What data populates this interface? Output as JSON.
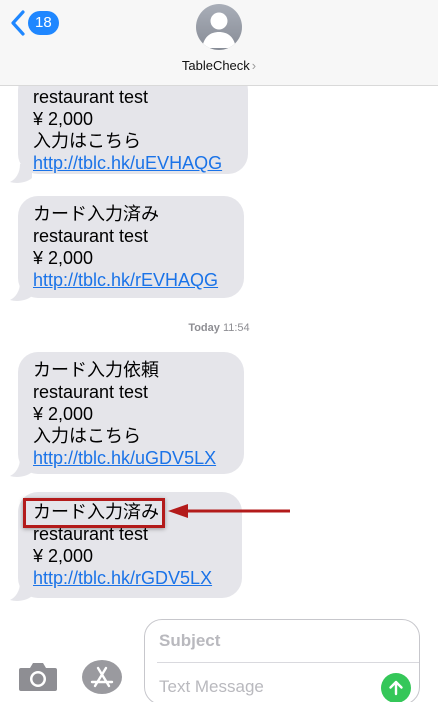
{
  "header": {
    "back_badge": "18",
    "contact_name": "TableCheck",
    "contact_chevron": "›"
  },
  "conversation": {
    "messages": [
      {
        "lines": [
          "restaurant test",
          "¥ 2,000",
          "入力はこちら"
        ],
        "link": "http://tblc.hk/uEVHAQG"
      },
      {
        "lines": [
          "カード入力済み",
          "restaurant test",
          "¥ 2,000"
        ],
        "link": "http://tblc.hk/rEVHAQG"
      },
      {
        "lines": [
          "カード入力依頼",
          "restaurant test",
          "¥ 2,000",
          "入力はこちら"
        ],
        "link": "http://tblc.hk/uGDV5LX"
      },
      {
        "lines": [
          "カード入力済み",
          "restaurant test",
          "¥ 2,000"
        ],
        "link": "http://tblc.hk/rGDV5LX"
      }
    ],
    "timestamp": {
      "day": "Today",
      "time": "11:54"
    }
  },
  "input": {
    "subject_placeholder": "Subject",
    "message_placeholder": "Text Message"
  },
  "icons": {
    "back": "chevron-left-icon",
    "avatar": "person-icon",
    "camera": "camera-icon",
    "appstore": "appstore-icon",
    "send": "arrow-up-icon"
  },
  "colors": {
    "accent": "#1f87ff",
    "bubble": "#e5e5ea",
    "link": "#1a73e8",
    "send": "#35c759",
    "annotation": "#b31b1b"
  }
}
